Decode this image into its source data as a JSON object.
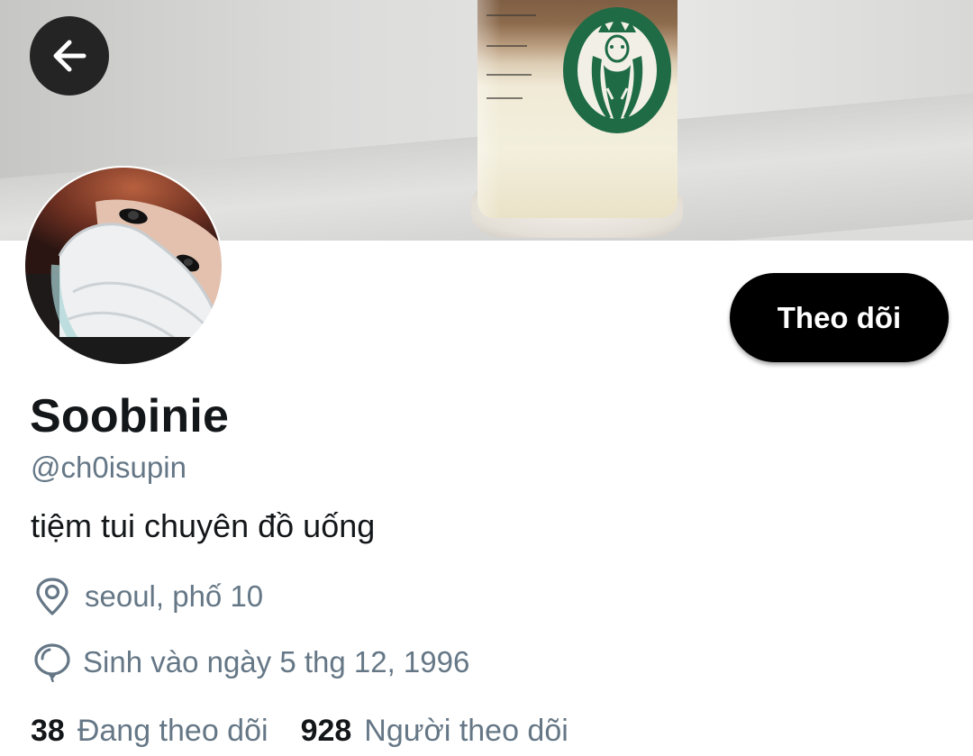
{
  "profile": {
    "display_name": "Soobinie",
    "handle": "@ch0isupin",
    "bio": "tiệm tui chuyên đồ uống",
    "location": "seoul, phố 10",
    "birthday": "Sinh vào ngày 5 thg 12, 1996"
  },
  "actions": {
    "follow_label": "Theo dõi"
  },
  "stats": {
    "following_count": "38",
    "following_label": "Đang theo dõi",
    "followers_count": "928",
    "followers_label": "Người theo dõi"
  },
  "icons": {
    "back": "arrow-left-icon",
    "location": "location-pin-icon",
    "birthday": "balloon-icon"
  },
  "colors": {
    "primary_text": "#14171a",
    "secondary_text": "#657786",
    "button_bg": "#000000",
    "button_text": "#ffffff"
  }
}
